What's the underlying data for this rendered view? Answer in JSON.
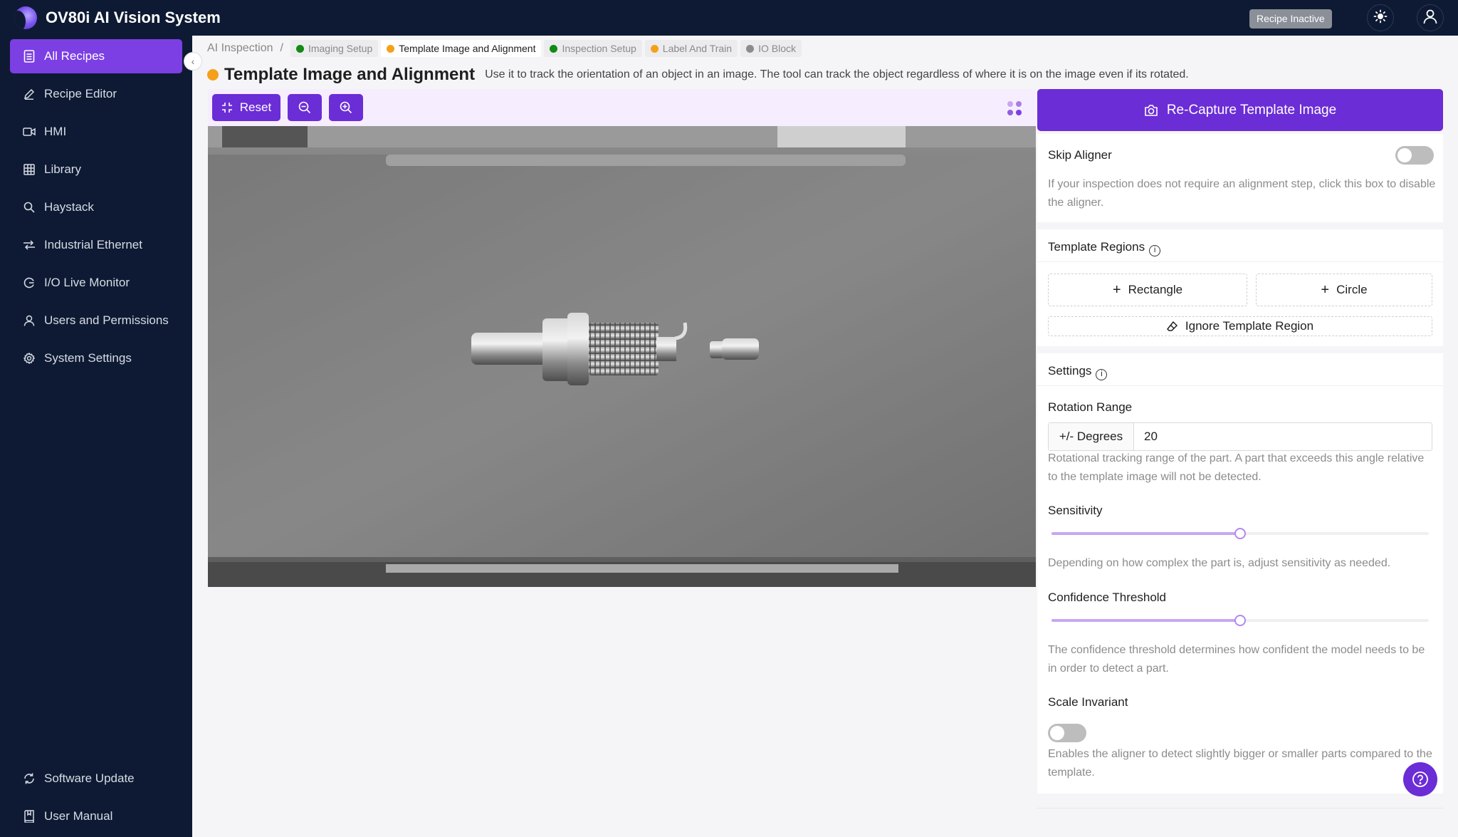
{
  "app": {
    "title": "OV80i AI Vision System",
    "recipe_status": "Recipe Inactive"
  },
  "sidebar": {
    "items": [
      {
        "label": "All Recipes",
        "icon": "recipe-list-icon",
        "active": true
      },
      {
        "label": "Recipe Editor",
        "icon": "pencil-icon"
      },
      {
        "label": "HMI",
        "icon": "camera-icon"
      },
      {
        "label": "Library",
        "icon": "grid-icon"
      },
      {
        "label": "Haystack",
        "icon": "search-icon"
      },
      {
        "label": "Industrial Ethernet",
        "icon": "network-icon"
      },
      {
        "label": "I/O Live Monitor",
        "icon": "monitor-icon"
      },
      {
        "label": "Users and Permissions",
        "icon": "user-icon"
      },
      {
        "label": "System Settings",
        "icon": "gear-icon"
      }
    ],
    "bottom": [
      {
        "label": "Software Update",
        "icon": "refresh-icon"
      },
      {
        "label": "User Manual",
        "icon": "book-icon"
      }
    ]
  },
  "breadcrumb": {
    "root": "AI Inspection",
    "separator": "/",
    "tabs": [
      {
        "label": "Imaging Setup",
        "status": "#138a13"
      },
      {
        "label": "Template Image and Alignment",
        "status": "#f5a01a",
        "active": true
      },
      {
        "label": "Inspection Setup",
        "status": "#138a13"
      },
      {
        "label": "Label And Train",
        "status": "#f5a01a"
      },
      {
        "label": "IO Block",
        "status": "#8c8c8c"
      }
    ]
  },
  "page": {
    "title": "Template Image and Alignment",
    "status_color": "#f5a01a",
    "description": "Use it to track the orientation of an object in an image. The tool can track the object regardless of where it is on the image even if its rotated."
  },
  "toolbar": {
    "reset_label": "Reset"
  },
  "panel": {
    "recapture_label": "Re-Capture Template Image",
    "skip_aligner": {
      "label": "Skip Aligner",
      "enabled": false,
      "help": "If your inspection does not require an alignment step, click this box to disable the aligner."
    },
    "template_regions": {
      "title": "Template Regions",
      "rectangle_label": "Rectangle",
      "circle_label": "Circle",
      "ignore_label": "Ignore Template Region"
    },
    "settings": {
      "title": "Settings",
      "rotation": {
        "label": "Rotation Range",
        "unit": "+/- Degrees",
        "value": "20",
        "help": "Rotational tracking range of the part. A part that exceeds this angle relative to the template image will not be detected."
      },
      "sensitivity": {
        "label": "Sensitivity",
        "value": 0.5,
        "help": "Depending on how complex the part is, adjust sensitivity as needed."
      },
      "confidence": {
        "label": "Confidence Threshold",
        "value": 0.5,
        "help": "The confidence threshold determines how confident the model needs to be in order to detect a part."
      },
      "scale_invariant": {
        "label": "Scale Invariant",
        "enabled": false,
        "help": "Enables the aligner to detect slightly bigger or smaller parts compared to the template."
      }
    }
  },
  "colors": {
    "accent": "#6b2dd6",
    "sidebar_bg": "#0e1a33",
    "active_nav": "#7b3fe4"
  }
}
